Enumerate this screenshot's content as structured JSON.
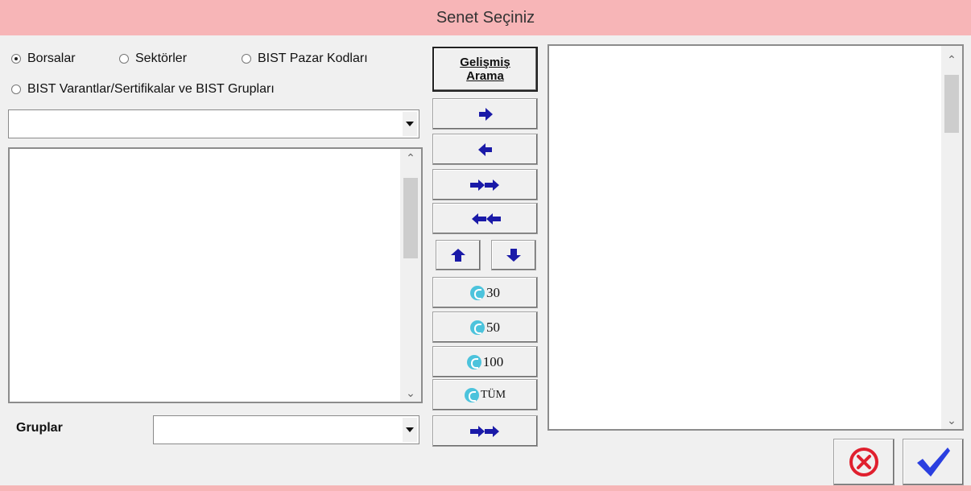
{
  "window": {
    "title": "Senet Seçiniz"
  },
  "filters": {
    "radio_borsalar": "Borsalar",
    "radio_sektorler": "Sektörler",
    "radio_bist_pazar": "BIST Pazar Kodları",
    "radio_bist_varant": "BIST Varantlar/Sertifikalar ve BIST Grupları",
    "selected": "Borsalar"
  },
  "buttons": {
    "advanced_search_line1": "Gelişmiş",
    "advanced_search_line2": "Arama",
    "bist30": "30",
    "bist50": "50",
    "bist100": "100",
    "bist_all": "TÜM"
  },
  "groups": {
    "label": "Gruplar"
  },
  "colors": {
    "title_bar": "#f7b5b7",
    "arrow_blue": "#1a1aa8",
    "ok_blue": "#2a3fe0",
    "cancel_red": "#e0202e",
    "bist_logo": "#4cc3dc"
  },
  "icons": [
    "arrow-right-icon",
    "arrow-left-icon",
    "double-arrow-right-icon",
    "double-arrow-left-icon",
    "arrow-up-icon",
    "arrow-down-icon",
    "cancel-icon",
    "checkmark-icon",
    "bist-logo-icon"
  ]
}
